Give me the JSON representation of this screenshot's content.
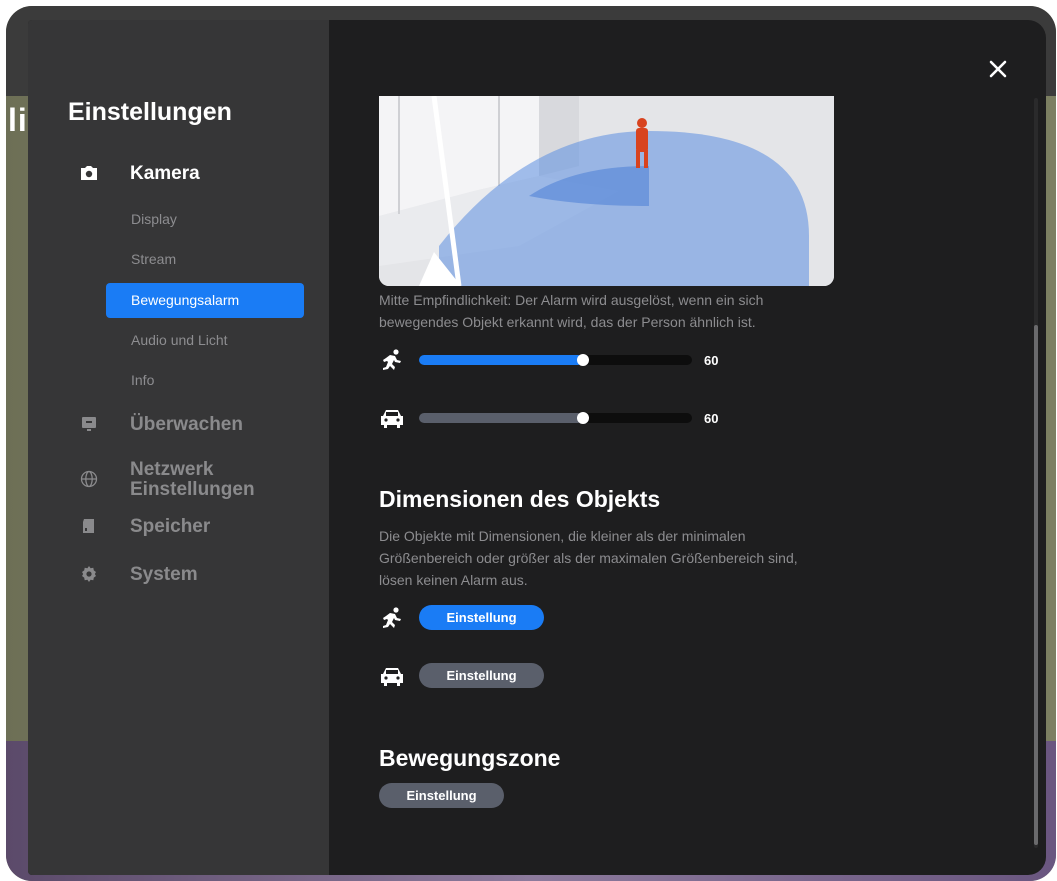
{
  "background": {
    "partial_text": "li"
  },
  "sidebar": {
    "title": "Einstellungen",
    "sections": [
      {
        "label": "Kamera",
        "icon": "camera-icon",
        "active": true
      },
      {
        "label": "Überwachen",
        "icon": "monitor-icon",
        "active": false
      },
      {
        "label": "Netzwerk Einstellungen",
        "icon": "globe-icon",
        "active": false
      },
      {
        "label": "Speicher",
        "icon": "sd-card-icon",
        "active": false
      },
      {
        "label": "System",
        "icon": "gear-icon",
        "active": false
      }
    ],
    "network_line1": "Netzwerk",
    "network_line2": "Einstellungen",
    "camera_items": [
      {
        "label": "Display",
        "active": false
      },
      {
        "label": "Stream",
        "active": false
      },
      {
        "label": "Bewegungsalarm",
        "active": true
      },
      {
        "label": "Audio und Licht",
        "active": false
      },
      {
        "label": "Info",
        "active": false
      }
    ]
  },
  "main": {
    "sensitivity_desc_line1": "Mitte Empfindlichkeit: Der Alarm wird ausgelöst, wenn ein sich",
    "sensitivity_desc_line2": "bewegendes Objekt erkannt wird, das der Person ähnlich ist.",
    "sliders": [
      {
        "icon": "person-running-icon",
        "value": 60,
        "max": 100,
        "fill_color": "#1a7cf5"
      },
      {
        "icon": "car-icon",
        "value": 60,
        "max": 100,
        "fill_color": "#5a5f6b"
      }
    ],
    "dimensions": {
      "title": "Dimensionen des Objekts",
      "desc_line1": "Die Objekte mit Dimensionen, die kleiner als der minimalen",
      "desc_line2": "Größenbereich oder größer als der maximalen Größenbereich sind,",
      "desc_line3": "lösen keinen Alarm aus.",
      "person_button": "Einstellung",
      "car_button": "Einstellung"
    },
    "zone": {
      "title": "Bewegungszone",
      "button": "Einstellung"
    }
  },
  "colors": {
    "accent": "#1a7cf5",
    "modal_bg": "#1e1e1f",
    "sidebar_bg": "#363637",
    "inactive_pill": "#5a5f6b"
  }
}
